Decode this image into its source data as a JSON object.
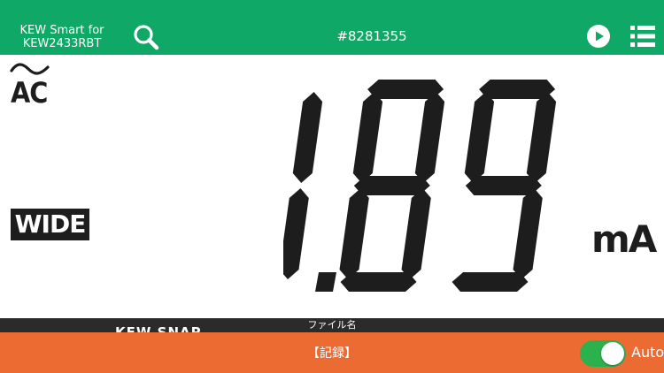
{
  "header": {
    "app_title_line1": "KEW Smart for",
    "app_title_line2": "KEW2433RBT",
    "device_id": "#8281355",
    "icons": {
      "search": "search-icon",
      "play": "play-icon",
      "menu": "list-menu-icon"
    }
  },
  "display": {
    "mode_symbol": "~",
    "mode": "AC",
    "range_badge": "WIDE",
    "reading": "1.89",
    "unit": "mA"
  },
  "strip": {
    "filename_label": "ファイル名",
    "kew_snap": "KEW SNAP"
  },
  "bottom": {
    "record_label": "【記録】",
    "auto_label": "Auto",
    "auto_enabled": true
  },
  "colors": {
    "header_bg": "#0fa866",
    "bottom_bg": "#ec6b33",
    "lcd_segment": "#1d1d1d",
    "toggle_on": "#2db14f"
  }
}
